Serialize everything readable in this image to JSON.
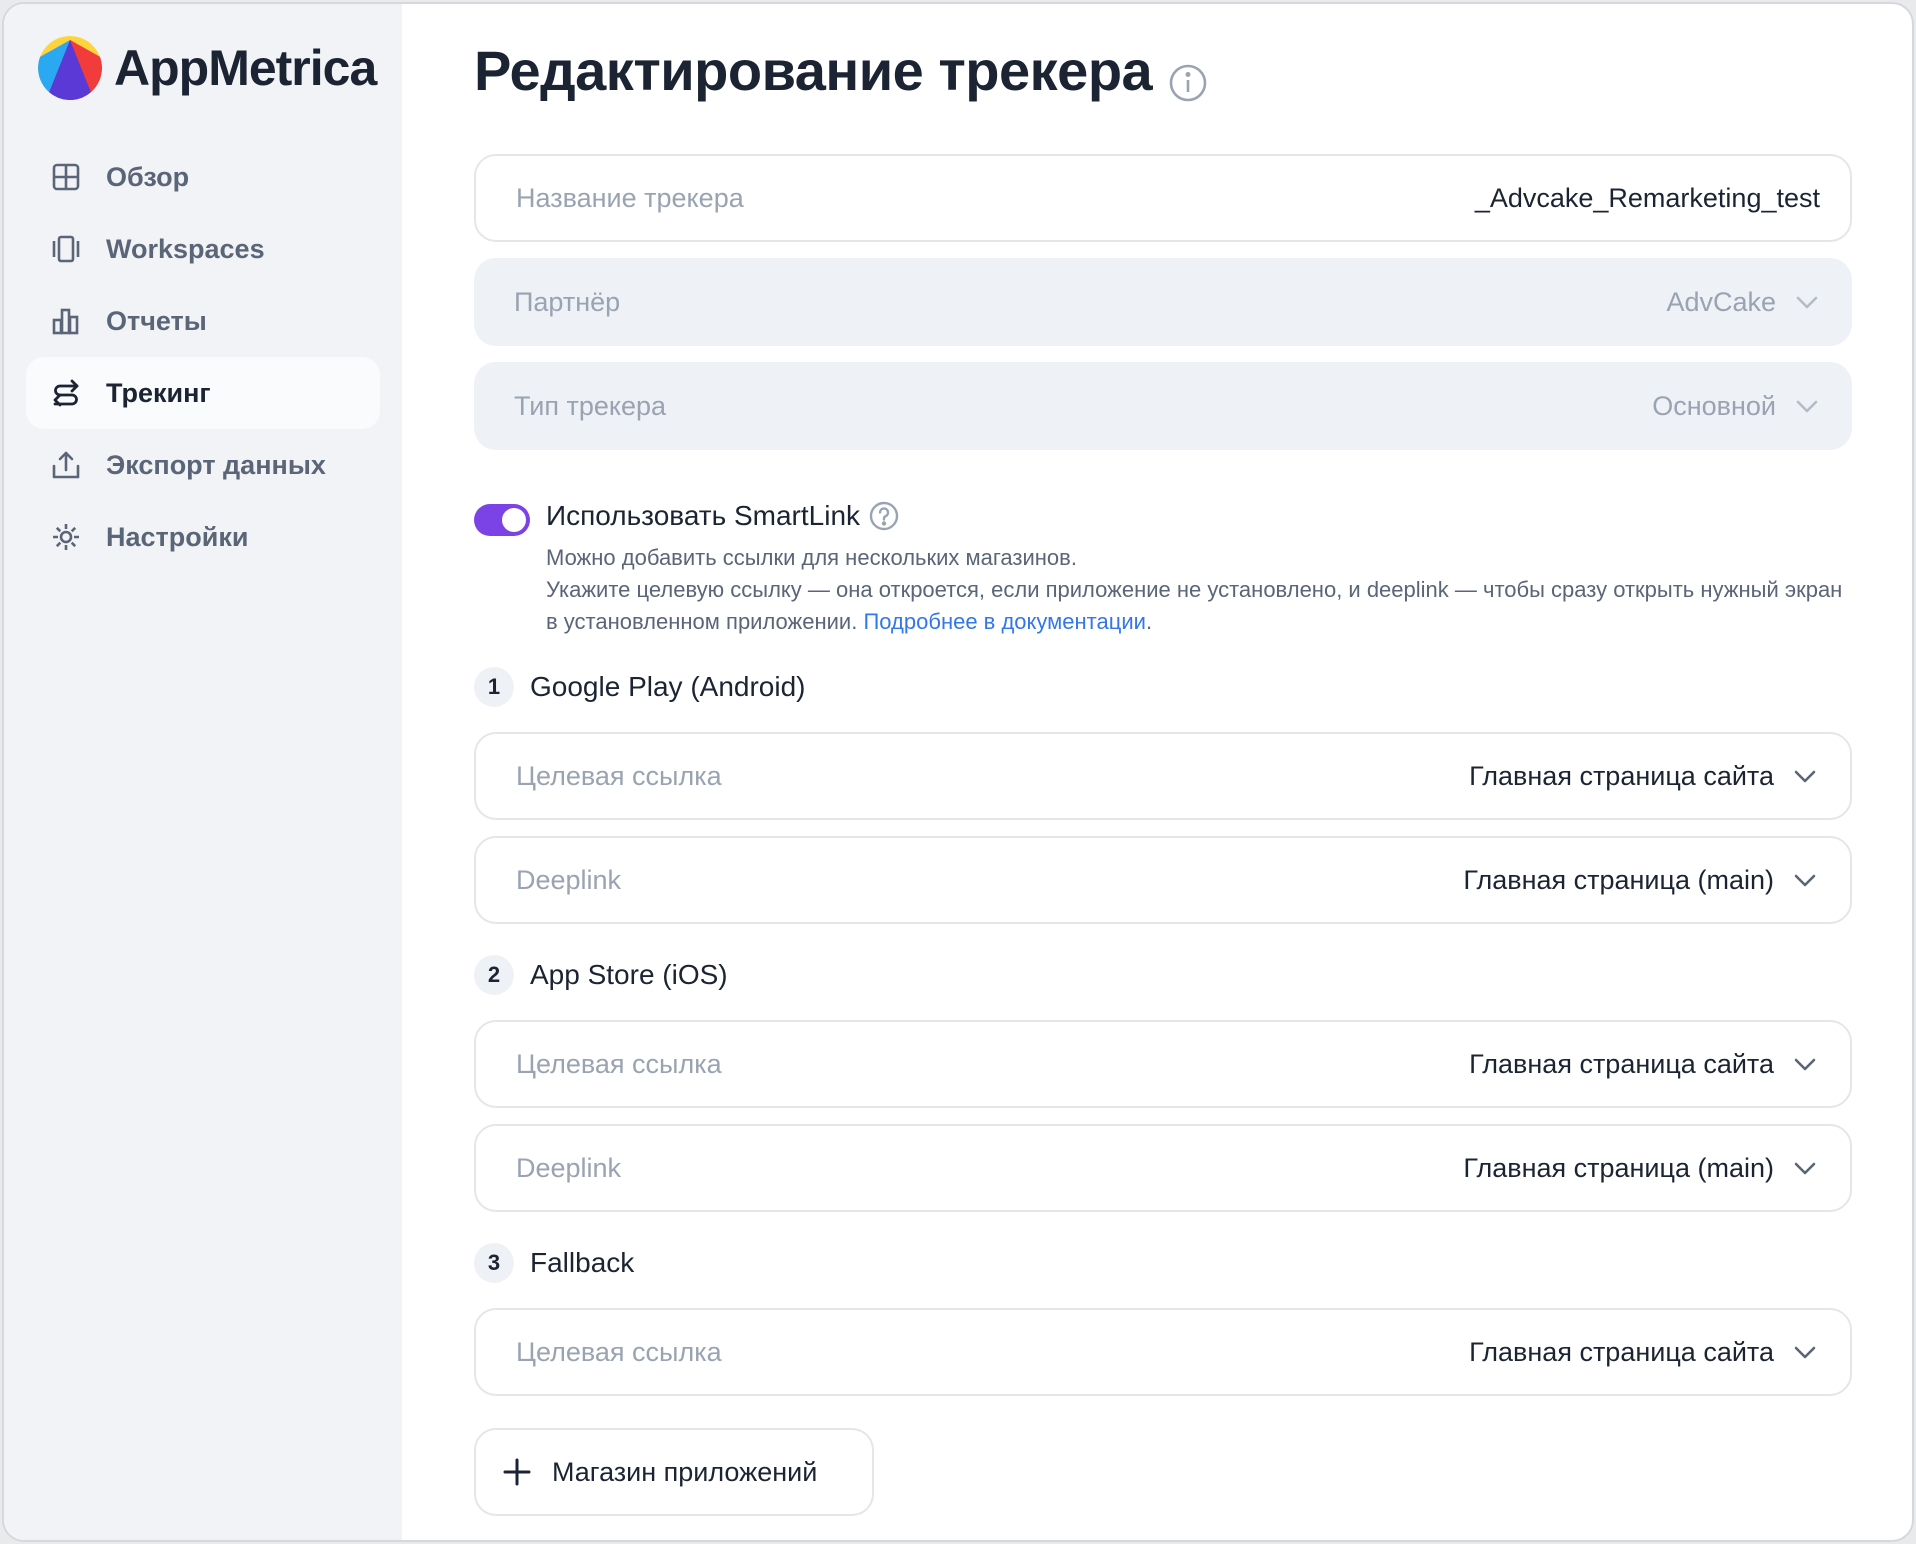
{
  "app": {
    "name": "AppMetrica"
  },
  "sidebar": {
    "items": [
      {
        "label": "Обзор",
        "icon": "grid-icon",
        "active": false
      },
      {
        "label": "Workspaces",
        "icon": "workspaces-icon",
        "active": false
      },
      {
        "label": "Отчеты",
        "icon": "bar-chart-icon",
        "active": false
      },
      {
        "label": "Трекинг",
        "icon": "tracking-arrows-icon",
        "active": true
      },
      {
        "label": "Экспорт данных",
        "icon": "export-icon",
        "active": false
      },
      {
        "label": "Настройки",
        "icon": "gear-icon",
        "active": false
      }
    ]
  },
  "page": {
    "title": "Редактирование трекера"
  },
  "form": {
    "tracker_name": {
      "label": "Название трекера",
      "value": "_Advcake_Remarketing_test"
    },
    "partner": {
      "label": "Партнёр",
      "value": "AdvCake"
    },
    "tracker_type": {
      "label": "Тип трекера",
      "value": "Основной"
    }
  },
  "smartlink": {
    "enabled": true,
    "title": "Использовать SmartLink",
    "desc_line1": "Можно добавить ссылки для нескольких магазинов.",
    "desc_line2": "Укажите целевую ссылку — она откроется, если приложение не установлено, и deeplink — чтобы сразу открыть нужный экран в установленном приложении.",
    "doc_link": "Подробнее в документации",
    "doc_link_suffix": "."
  },
  "stores": [
    {
      "num": "1",
      "title": "Google Play (Android)",
      "target": {
        "label": "Целевая ссылка",
        "value": "Главная страница сайта"
      },
      "deeplink": {
        "label": "Deeplink",
        "value": "Главная страница (main)"
      }
    },
    {
      "num": "2",
      "title": "App Store (iOS)",
      "target": {
        "label": "Целевая ссылка",
        "value": "Главная страница сайта"
      },
      "deeplink": {
        "label": "Deeplink",
        "value": "Главная страница (main)"
      }
    },
    {
      "num": "3",
      "title": "Fallback",
      "target": {
        "label": "Целевая ссылка",
        "value": "Главная страница сайта"
      }
    }
  ],
  "add_store": {
    "label": "Магазин приложений"
  },
  "colors": {
    "accent": "#7b43e6",
    "link": "#3377e8",
    "text": "#1c2433",
    "muted": "#9aa3b2"
  }
}
